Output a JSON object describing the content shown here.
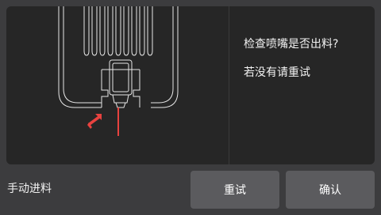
{
  "dialog": {
    "message_line1": "检查喷嘴是否出料?",
    "message_line2": "若没有请重试"
  },
  "footer": {
    "manual_feed_label": "手动进料",
    "retry_label": "重试",
    "confirm_label": "确认"
  },
  "colors": {
    "background": "#3c3c3e",
    "panel": "#262626",
    "button": "#5b5b5e",
    "outline": "#e6e6e6",
    "accent_red": "#e8423f"
  },
  "icons": {
    "illustration": "extruder-nozzle-illustration",
    "pointer": "red-arrow-icon",
    "filament": "filament-line-icon"
  }
}
